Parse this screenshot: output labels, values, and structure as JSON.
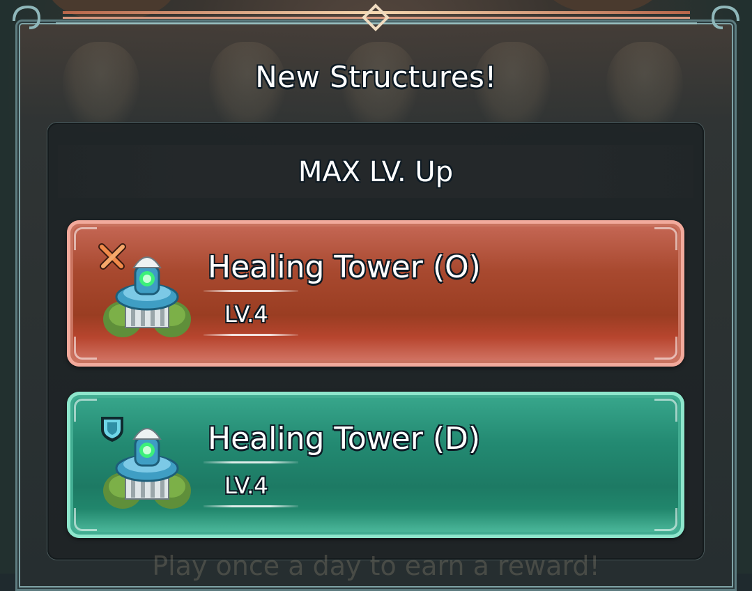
{
  "dialog": {
    "title": "New Structures!",
    "section_label": "MAX LV. Up"
  },
  "structures": [
    {
      "name": "Healing Tower (O)",
      "level": "LV.4",
      "type": "offense",
      "badge_icon": "crossed-swords-icon",
      "color": "#a8492f"
    },
    {
      "name": "Healing Tower (D)",
      "level": "LV.4",
      "type": "defense",
      "badge_icon": "shield-icon",
      "color": "#238a72"
    }
  ],
  "background": {
    "footer_text": "Play once a day to earn a reward!"
  }
}
